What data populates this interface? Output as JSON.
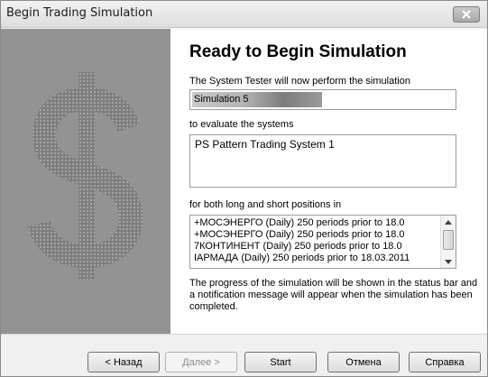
{
  "window": {
    "title": "Begin Trading Simulation"
  },
  "icons": {
    "close": "close-icon",
    "dollar": "dollar-sign-icon",
    "scroll_up": "arrow-up-icon",
    "scroll_down": "arrow-down-icon"
  },
  "content": {
    "heading": "Ready to Begin Simulation",
    "intro_label": "The System Tester will now perform the simulation",
    "simulation_value": "Simulation 5",
    "evaluate_label": "to evaluate the systems",
    "systems_value": "PS Pattern Trading System 1",
    "positions_label": "for both long and short positions in",
    "positions": [
      "+МОСЭНЕРГО (Daily)          250 periods prior to 18.0",
      "+МОСЭНЕРГО (Daily)          250 periods prior to 18.0",
      "7КОНТИНЕНТ (Daily)          250 periods prior to 18.0",
      "IАРМАДА (Daily)    250 periods prior to 18.03.2011"
    ],
    "footer": "The progress of the simulation will be shown in the status bar and a notification message will appear when the simulation has been completed."
  },
  "buttons": {
    "back": "< Назад",
    "next": "Далее >",
    "start": "Start",
    "cancel": "Отмена",
    "help": "Справка"
  },
  "colors": {
    "side_panel": "#939393",
    "window_bg": "#f0f0f0"
  }
}
